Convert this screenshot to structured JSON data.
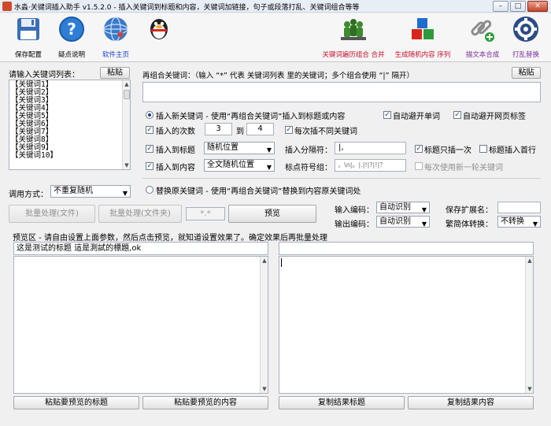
{
  "window": {
    "title": "水淼·关键词插入助手 v1.5.2.0 - 插入关键词到标题和内容，关键词加链接，句子或段落打乱、关键词组合等等",
    "min": "–",
    "max": "□",
    "close": "✕"
  },
  "toolbar": {
    "save": "保存配置",
    "help": "疑点说明",
    "home": "软件主页",
    "combine": "关键词遍历组合 合并",
    "random": "生成随机内容 序列",
    "merge": "描文本合成",
    "shuffle": "打乱替换"
  },
  "keywords": {
    "label": "请输入关键词列表：",
    "paste": "粘贴",
    "items": [
      "【关键词1】",
      "【关键词2】",
      "【关键词3】",
      "【关键词4】",
      "【关键词5】",
      "【关键词6】",
      "【关键词7】",
      "【关键词8】",
      "【关键词9】",
      "【关键词10】"
    ]
  },
  "combo": {
    "label": "再组合关键词：（输入 “*” 代表 关键词列表 里的关键词；多个组合使用 “|” 隔开）",
    "paste": "粘贴"
  },
  "mode": {
    "label": "调用方式：",
    "value": "不重复随机"
  },
  "insert": {
    "radio_label": "插入新关键词 - 使用“再组合关键词”插入到标题或内容",
    "avoid_words": "自动避开单词",
    "avoid_tags": "自动避开网页标签",
    "count_label": "插入的次数",
    "count_from": "3",
    "count_to_label": "到",
    "count_to": "4",
    "diff_each": "每次插不同关键词",
    "to_title": "插入到标题",
    "title_pos": "随机位置",
    "sep_label": "插入分隔符：",
    "sep_value": "|,",
    "title_once": "标题只插一次",
    "title_first": "标题插入首行",
    "to_content": "插入到内容",
    "content_pos": "全文随机位置",
    "punct_label": "标点符号组：",
    "punct_value": "，\\n|。|.|!|?|!|？",
    "new_round": "每次使用新一轮关键词"
  },
  "replace": {
    "radio_label": "替换原关键词 - 使用“再组合关键词”替换到内容原关键词处"
  },
  "batch": {
    "file": "批量处理(文件)",
    "folder": "批量处理(文件夹)",
    "ext": "*.*",
    "preview": "预览"
  },
  "encoding": {
    "in_label": "输入编码：",
    "in_value": "自动识别",
    "out_label": "输出编码：",
    "out_value": "自动识别",
    "save_ext_label": "保存扩展名：",
    "save_ext_value": "",
    "conv_label": "繁简体转换：",
    "conv_value": "不转换"
  },
  "preview": {
    "label": "预览区 - 请自由设置上面参数，然后点击预览，就知道设置效果了。确定效果后再批量处理",
    "title_value": "这是测试的标题 這是測試的標題,ok",
    "result_title": "",
    "paste_title": "粘贴要预览的标题",
    "paste_content": "粘贴要预览的内容",
    "copy_title": "复制结果标题",
    "copy_content": "复制结果内容"
  }
}
